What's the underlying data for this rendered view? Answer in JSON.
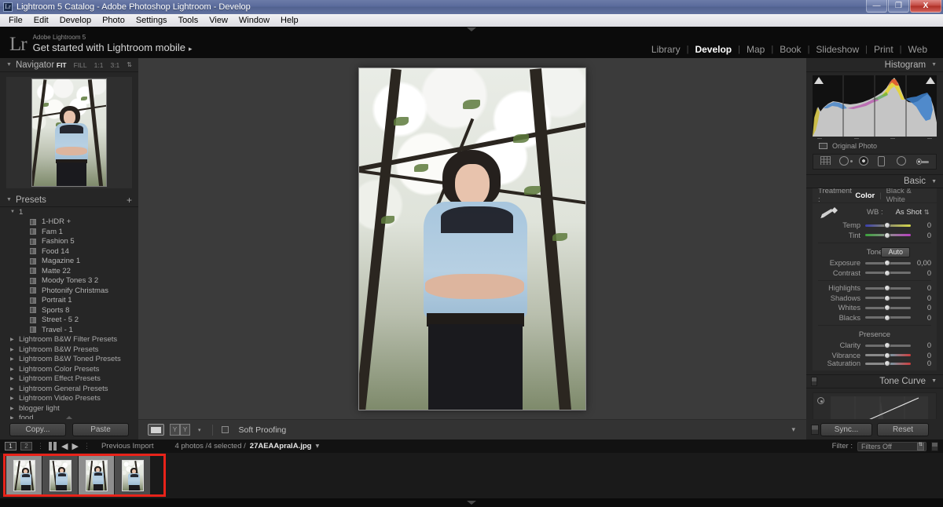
{
  "window": {
    "title": "Lightroom 5 Catalog - Adobe Photoshop Lightroom - Develop",
    "app_icon": "lightroom-icon",
    "minimize_label": "—",
    "restore_label": "❐",
    "close_label": "X"
  },
  "menubar": {
    "items": [
      "File",
      "Edit",
      "Develop",
      "Photo",
      "Settings",
      "Tools",
      "View",
      "Window",
      "Help"
    ]
  },
  "identity": {
    "logo": "Lr",
    "small_line": "Adobe Lightroom 5",
    "big_line": "Get started with Lightroom mobile",
    "arrow": "▸"
  },
  "modules": {
    "items": [
      {
        "label": "Library",
        "active": false
      },
      {
        "label": "Develop",
        "active": true
      },
      {
        "label": "Map",
        "active": false
      },
      {
        "label": "Book",
        "active": false
      },
      {
        "label": "Slideshow",
        "active": false
      },
      {
        "label": "Print",
        "active": false
      },
      {
        "label": "Web",
        "active": false
      }
    ],
    "separator": "|"
  },
  "navigator": {
    "title": "Navigator",
    "collapse_tri": "▼",
    "zoom_levels": [
      {
        "label": "FIT",
        "active": true
      },
      {
        "label": "FILL",
        "active": false
      },
      {
        "label": "1:1",
        "active": false
      },
      {
        "label": "3:1",
        "active": false
      }
    ],
    "stepper": "⇅"
  },
  "presets": {
    "title": "Presets",
    "collapse_tri": "▼",
    "add_label": "+",
    "group_open": {
      "tri": "▼",
      "label": "1"
    },
    "items": [
      "1-HDR +",
      "Fam 1",
      "Fashion 5",
      "Food 14",
      "Magazine 1",
      "Matte 22",
      "Moody Tones 3 2",
      "Photonify Christmas",
      "Portrait 1",
      "Sports 8",
      "Street - 5 2",
      "Travel - 1"
    ],
    "groups": [
      "Lightroom B&W Filter Presets",
      "Lightroom B&W Presets",
      "Lightroom B&W Toned Presets",
      "Lightroom Color Presets",
      "Lightroom Effect Presets",
      "Lightroom General Presets",
      "Lightroom Video Presets",
      "blogger light",
      "food"
    ],
    "group_tri": "▶"
  },
  "left_bottom": {
    "copy_label": "Copy...",
    "paste_label": "Paste"
  },
  "toolbar": {
    "loupe_icon": "loupe-view-icon",
    "before_after_a": "Y",
    "before_after_b": "Y",
    "caret": "▾",
    "soft_proofing_label": "Soft Proofing",
    "soft_proofing_checked": false,
    "right_caret": "▾"
  },
  "histogram": {
    "title": "Histogram",
    "collapse_tri": "▼",
    "original_photo_label": "Original Photo",
    "clip_left": "▲",
    "clip_right": "▲"
  },
  "tools": {
    "items": [
      "crop-overlay-icon",
      "spot-removal-icon",
      "red-eye-icon",
      "graduated-filter-icon",
      "radial-filter-icon",
      "adjustment-brush-icon"
    ]
  },
  "basic": {
    "title": "Basic",
    "collapse_tri": "▼",
    "treatment_label": "Treatment :",
    "treatment_options": [
      {
        "label": "Color",
        "active": true
      },
      {
        "label": "Black & White",
        "active": false
      }
    ],
    "wb_label": "WB :",
    "wb_value": "As Shot",
    "wb_stepper": "⇅",
    "white_balance_sliders": [
      {
        "name": "Temp",
        "value": "0",
        "track": "temp",
        "knob": 48
      },
      {
        "name": "Tint",
        "value": "0",
        "track": "tint",
        "knob": 48
      }
    ],
    "tone_label": "Tone",
    "auto_label": "Auto",
    "tone_sliders": [
      {
        "name": "Exposure",
        "value": "0,00",
        "track": "plain",
        "knob": 48
      },
      {
        "name": "Contrast",
        "value": "0",
        "track": "plain",
        "knob": 48
      }
    ],
    "tone_sliders2": [
      {
        "name": "Highlights",
        "value": "0",
        "track": "plain",
        "knob": 48
      },
      {
        "name": "Shadows",
        "value": "0",
        "track": "plain",
        "knob": 48
      },
      {
        "name": "Whites",
        "value": "0",
        "track": "plain",
        "knob": 48
      },
      {
        "name": "Blacks",
        "value": "0",
        "track": "plain",
        "knob": 48
      }
    ],
    "presence_label": "Presence",
    "presence_sliders": [
      {
        "name": "Clarity",
        "value": "0",
        "track": "plain",
        "knob": 48
      },
      {
        "name": "Vibrance",
        "value": "0",
        "track": "vib",
        "knob": 48
      },
      {
        "name": "Saturation",
        "value": "0",
        "track": "sat",
        "knob": 48
      }
    ]
  },
  "tone_curve": {
    "title": "Tone Curve",
    "collapse_tri": "▼",
    "target_icon": "targeted-adjustment-icon"
  },
  "right_bottom": {
    "sync_label": "Sync...",
    "reset_label": "Reset"
  },
  "filmstrip_bar": {
    "page_1": "1",
    "page_2": "2",
    "grid_icon": "grid-view-icon",
    "back_arrow": "◀",
    "forward_arrow": "▶",
    "source_label": "Previous Import",
    "count_label": "4 photos /4 selected /",
    "filename": "27AEAApralA.jpg",
    "filename_caret": "▾",
    "filter_label": "Filter :",
    "filter_value": "Filters Off",
    "filter_caret": "⇅"
  },
  "filmstrip": {
    "thumbnails": [
      {
        "selected": true
      },
      {
        "selected": false
      },
      {
        "selected": true
      },
      {
        "selected": false
      }
    ],
    "annotation": "red-highlight-box"
  },
  "colors": {
    "accent_red": "#e8231a",
    "panel_bg": "#262626",
    "center_bg": "#3b3b3b",
    "title_blue": "#5a6b9c"
  }
}
